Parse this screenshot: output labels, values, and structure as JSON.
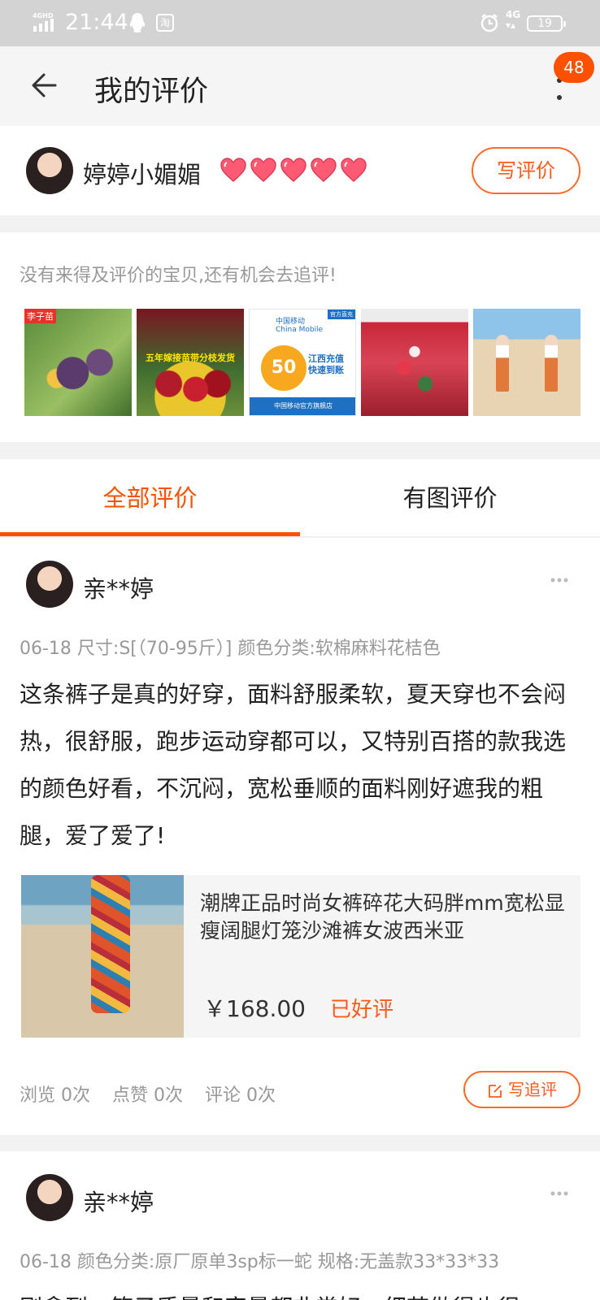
{
  "status_bar": {
    "time": "21:44",
    "network": "4G",
    "signal_label": "4GHD",
    "taobao_icon": "淘",
    "battery": "19"
  },
  "header": {
    "title": "我的评价",
    "badge": "48"
  },
  "profile": {
    "name": "婷婷小媚媚",
    "hearts": 5,
    "write_button": "写评价"
  },
  "pending": {
    "hint": "没有来得及评价的宝贝,还有机会去追评!",
    "thumb1_tag": "李子苗",
    "thumb2_text": "五年嫁接苗带分枝发货",
    "thumb3_logo": "中国移动\nChina Mobile",
    "thumb3_corner": "官方直充",
    "thumb3_amount": "50",
    "thumb3_text": "江西充值\n快速到账",
    "thumb3_bar": "中国移动官方旗舰店"
  },
  "tabs": {
    "all": "全部评价",
    "with_images": "有图评价"
  },
  "review1": {
    "name": "亲**婷",
    "meta": "06-18  尺寸:S[（70-95斤）] 颜色分类:软棉麻料花桔色",
    "body": "这条裤子是真的好穿，面料舒服柔软，夏天穿也不会闷热，很舒服，跑步运动穿都可以，又特别百搭的款我选的颜色好看，不沉闷，宽松垂顺的面料刚好遮我的粗腿，爱了爱了!",
    "product_title": "潮牌正品时尚女裤碎花大码胖mm宽松显瘦阔腿灯笼沙滩裤女波西米亚",
    "price": "￥168.00",
    "status": "已好评",
    "views": "浏览 0次",
    "likes": "点赞 0次",
    "comments": "评论 0次",
    "follow_button": "写追评"
  },
  "review2": {
    "name": "亲**婷",
    "meta": "06-18  颜色分类:原厂原单3sp标一蛇 规格:无盖款33*33*33",
    "body": "刚拿到，箱子质量和容量都非常好，细节做得也很"
  }
}
